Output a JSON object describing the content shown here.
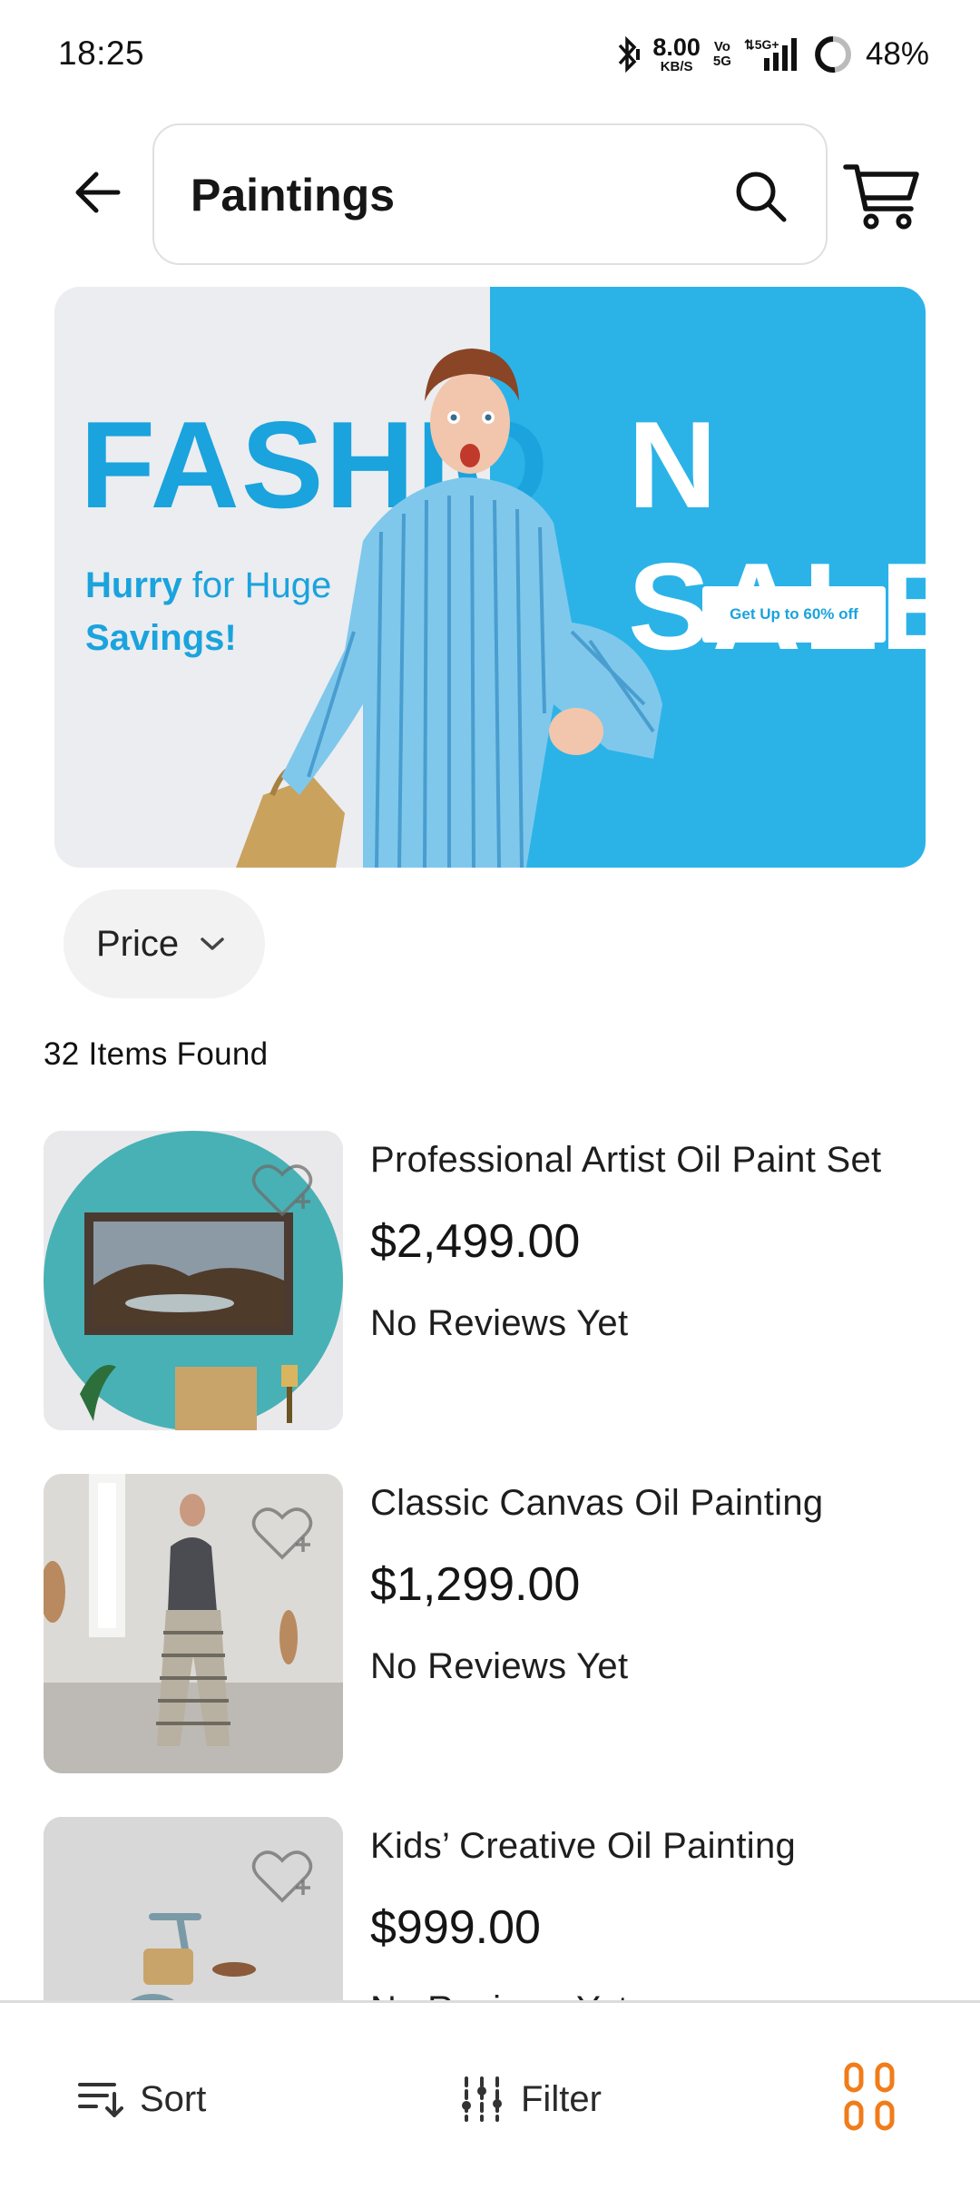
{
  "status_bar": {
    "time": "18:25",
    "net_speed_value": "8.00",
    "net_speed_unit": "KB/S",
    "volte_top": "Vo",
    "volte_bottom": "5G",
    "battery": "48%"
  },
  "header": {
    "search_value": "Paintings",
    "icons": [
      "back-arrow-icon",
      "search-icon",
      "cart-icon"
    ]
  },
  "banner": {
    "title_left": "FASHIO",
    "title_right": "N SALE",
    "subtitle_bold": "Hurry",
    "subtitle_rest": " for Huge",
    "subtitle_line2": "Savings!",
    "cta": "Get Up to 60% off",
    "colors": {
      "left_bg": "#ebedf0",
      "right_bg": "#2bb3e8",
      "accent": "#1aa3dd"
    }
  },
  "filters": {
    "price_label": "Price"
  },
  "results": {
    "count_text": "32 Items Found"
  },
  "products": [
    {
      "name": "Professional Artist Oil Paint Set",
      "price": "$2,499.00",
      "reviews": "No Reviews Yet"
    },
    {
      "name": "Classic Canvas Oil Painting",
      "price": "$1,299.00",
      "reviews": "No Reviews Yet"
    },
    {
      "name": "Kids’ Creative Oil Painting",
      "price": "$999.00",
      "reviews": "No Reviews Yet"
    }
  ],
  "bottom_bar": {
    "sort_label": "Sort",
    "filter_label": "Filter",
    "grid_icon_color": "#f07c1a"
  }
}
